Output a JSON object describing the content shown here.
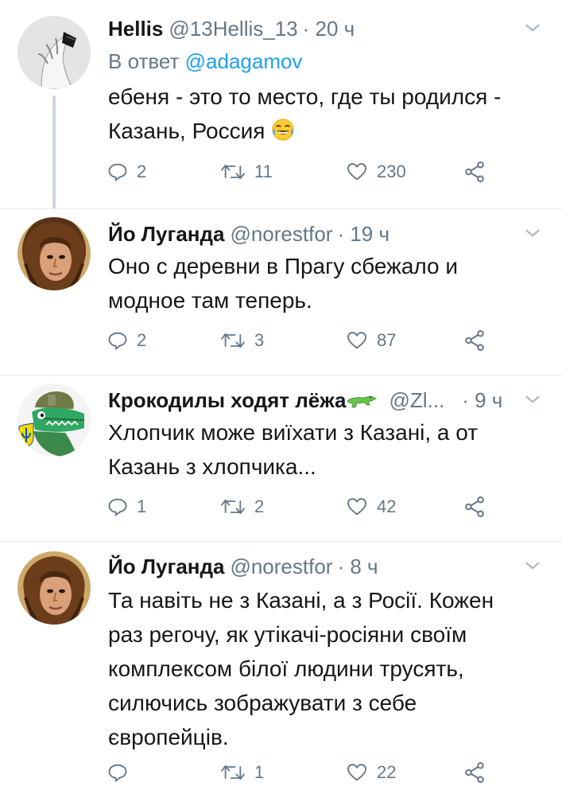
{
  "tweets": [
    {
      "name": "Hellis",
      "handle": "@13Hellis_13",
      "time": "· 20 ч",
      "reply_prefix": "В ответ",
      "reply_mention": "@adagamov",
      "text_line1": "ебеня - это то место, где ты родился -",
      "text_line2": "Казань, Россия",
      "replies": "2",
      "retweets": "11",
      "likes": "230"
    },
    {
      "name": "Йо Луганда",
      "handle": "@norestfor",
      "time": "· 19 ч",
      "text_line1": "Оно с деревни в Прагу сбежало и",
      "text_line2": "модное там теперь.",
      "replies": "2",
      "retweets": "3",
      "likes": "87"
    },
    {
      "name": "Крокодилы ходят лёжа",
      "handle": "@Zl...",
      "time": "· 9 ч",
      "text_line1": "Хлопчик може виїхати з Казані, а от",
      "text_line2": "Казань з хлопчика...",
      "replies": "1",
      "retweets": "2",
      "likes": "42"
    },
    {
      "name": "Йо Луганда",
      "handle": "@norestfor",
      "time": "· 8 ч",
      "text_line1": "Та навіть не з Казані, а з Росії. Кожен",
      "text_line2": "раз регочу, як утікачі-росіяни своїм",
      "text_line3": "комплексом білої людини трусять,",
      "text_line4": "силючись зображувати з себе",
      "text_line5": "європейців.",
      "replies": "",
      "retweets": "1",
      "likes": "22"
    }
  ],
  "colors": {
    "text": "#14171a",
    "secondary": "#657786",
    "link": "#1da1f2",
    "divider": "#e6ecf0",
    "thread_line": "#ccd6dd"
  },
  "icons": [
    "reply-icon",
    "retweet-icon",
    "like-icon",
    "share-icon",
    "chevron-down-icon",
    "face-with-tears-of-joy-emoji",
    "crocodile-emoji"
  ]
}
